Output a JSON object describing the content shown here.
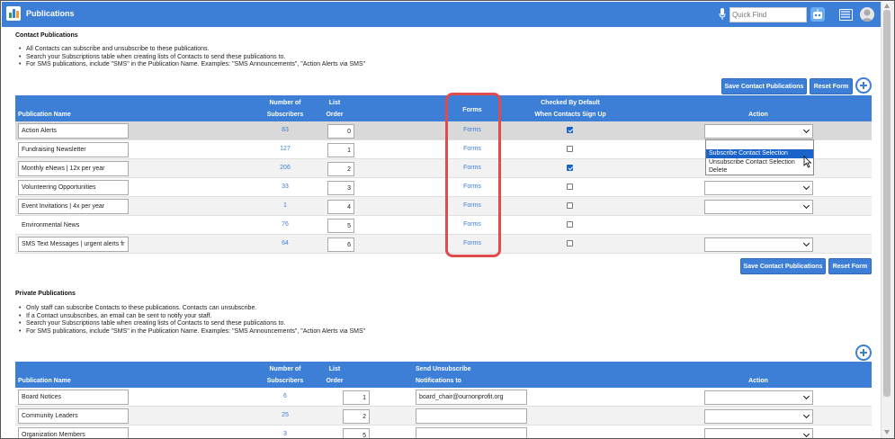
{
  "app": {
    "title": "Publications",
    "search_placeholder": "Quick Find"
  },
  "contact_section": {
    "title": "Contact Publications",
    "bullets": [
      "All Contacts can subscribe and unsubscribe to these publications.",
      "Search your Subscriptions table when creating lists of Contacts to send these publications to.",
      "For SMS publications, include \"SMS\" in the Publication Name. Examples: \"SMS Announcements\", \"Action Alerts via SMS\""
    ],
    "save_label": "Save Contact Publications",
    "reset_label": "Reset Form",
    "headers": {
      "name": "Publication Name",
      "subs_1": "Number of",
      "subs_2": "Subscribers",
      "order_1": "List",
      "order_2": "Order",
      "forms": "Forms",
      "checked_1": "Checked By Default",
      "checked_2": "When Contacts Sign Up",
      "action": "Action"
    },
    "rows": [
      {
        "name": "Action Alerts",
        "subscribers": "83",
        "order": "0",
        "forms": "Forms",
        "checked": true
      },
      {
        "name": "Fundraising Newsletter",
        "subscribers": "127",
        "order": "1",
        "forms": "Forms",
        "checked": false
      },
      {
        "name": "Monthly eNews | 12x per year",
        "subscribers": "206",
        "order": "2",
        "forms": "Forms",
        "checked": true
      },
      {
        "name": "Volunteering Opportunities",
        "subscribers": "33",
        "order": "3",
        "forms": "Forms",
        "checked": false
      },
      {
        "name": "Event Invitations | 4x per year",
        "subscribers": "1",
        "order": "4",
        "forms": "Forms",
        "checked": false
      },
      {
        "name": "Environmental News",
        "subscribers": "76",
        "order": "5",
        "forms": "Forms",
        "checked": false
      },
      {
        "name": "SMS Text Messages | urgent alerts fr",
        "subscribers": "64",
        "order": "6",
        "forms": "Forms",
        "checked": false
      }
    ],
    "action_dropdown": {
      "options": [
        "Subscribe Contact Selection",
        "Unsubscribe Contact Selection",
        "Delete"
      ],
      "selected": "Subscribe Contact Selection"
    }
  },
  "private_section": {
    "title": "Private Publications",
    "bullets": [
      "Only staff can subscribe Contacts to these publications. Contacts can unsubscribe.",
      "If a Contact unsubscribes, an email can be sent to notify your staff.",
      "Search your Subscriptions table when creating lists of Contacts to send these publications to.",
      "For SMS publications, include \"SMS\" in the Publication Name. Examples: \"SMS Announcements\", \"Action Alerts via SMS\""
    ],
    "headers": {
      "name": "Publication Name",
      "subs_1": "Number of",
      "subs_2": "Subscribers",
      "order_1": "List",
      "order_2": "Order",
      "notify_1": "Send Unsubscribe",
      "notify_2": "Notifications to",
      "action": "Action"
    },
    "rows": [
      {
        "name": "Board Notices",
        "subscribers": "6",
        "order": "1",
        "notify": "board_chair@ournonprofit.org"
      },
      {
        "name": "Community Leaders",
        "subscribers": "25",
        "order": "2",
        "notify": ""
      },
      {
        "name": "Organization Members",
        "subscribers": "3",
        "order": "5",
        "notify": ""
      }
    ]
  },
  "colors": {
    "accent": "#3d7fd6",
    "highlight": "#e04b4b"
  }
}
